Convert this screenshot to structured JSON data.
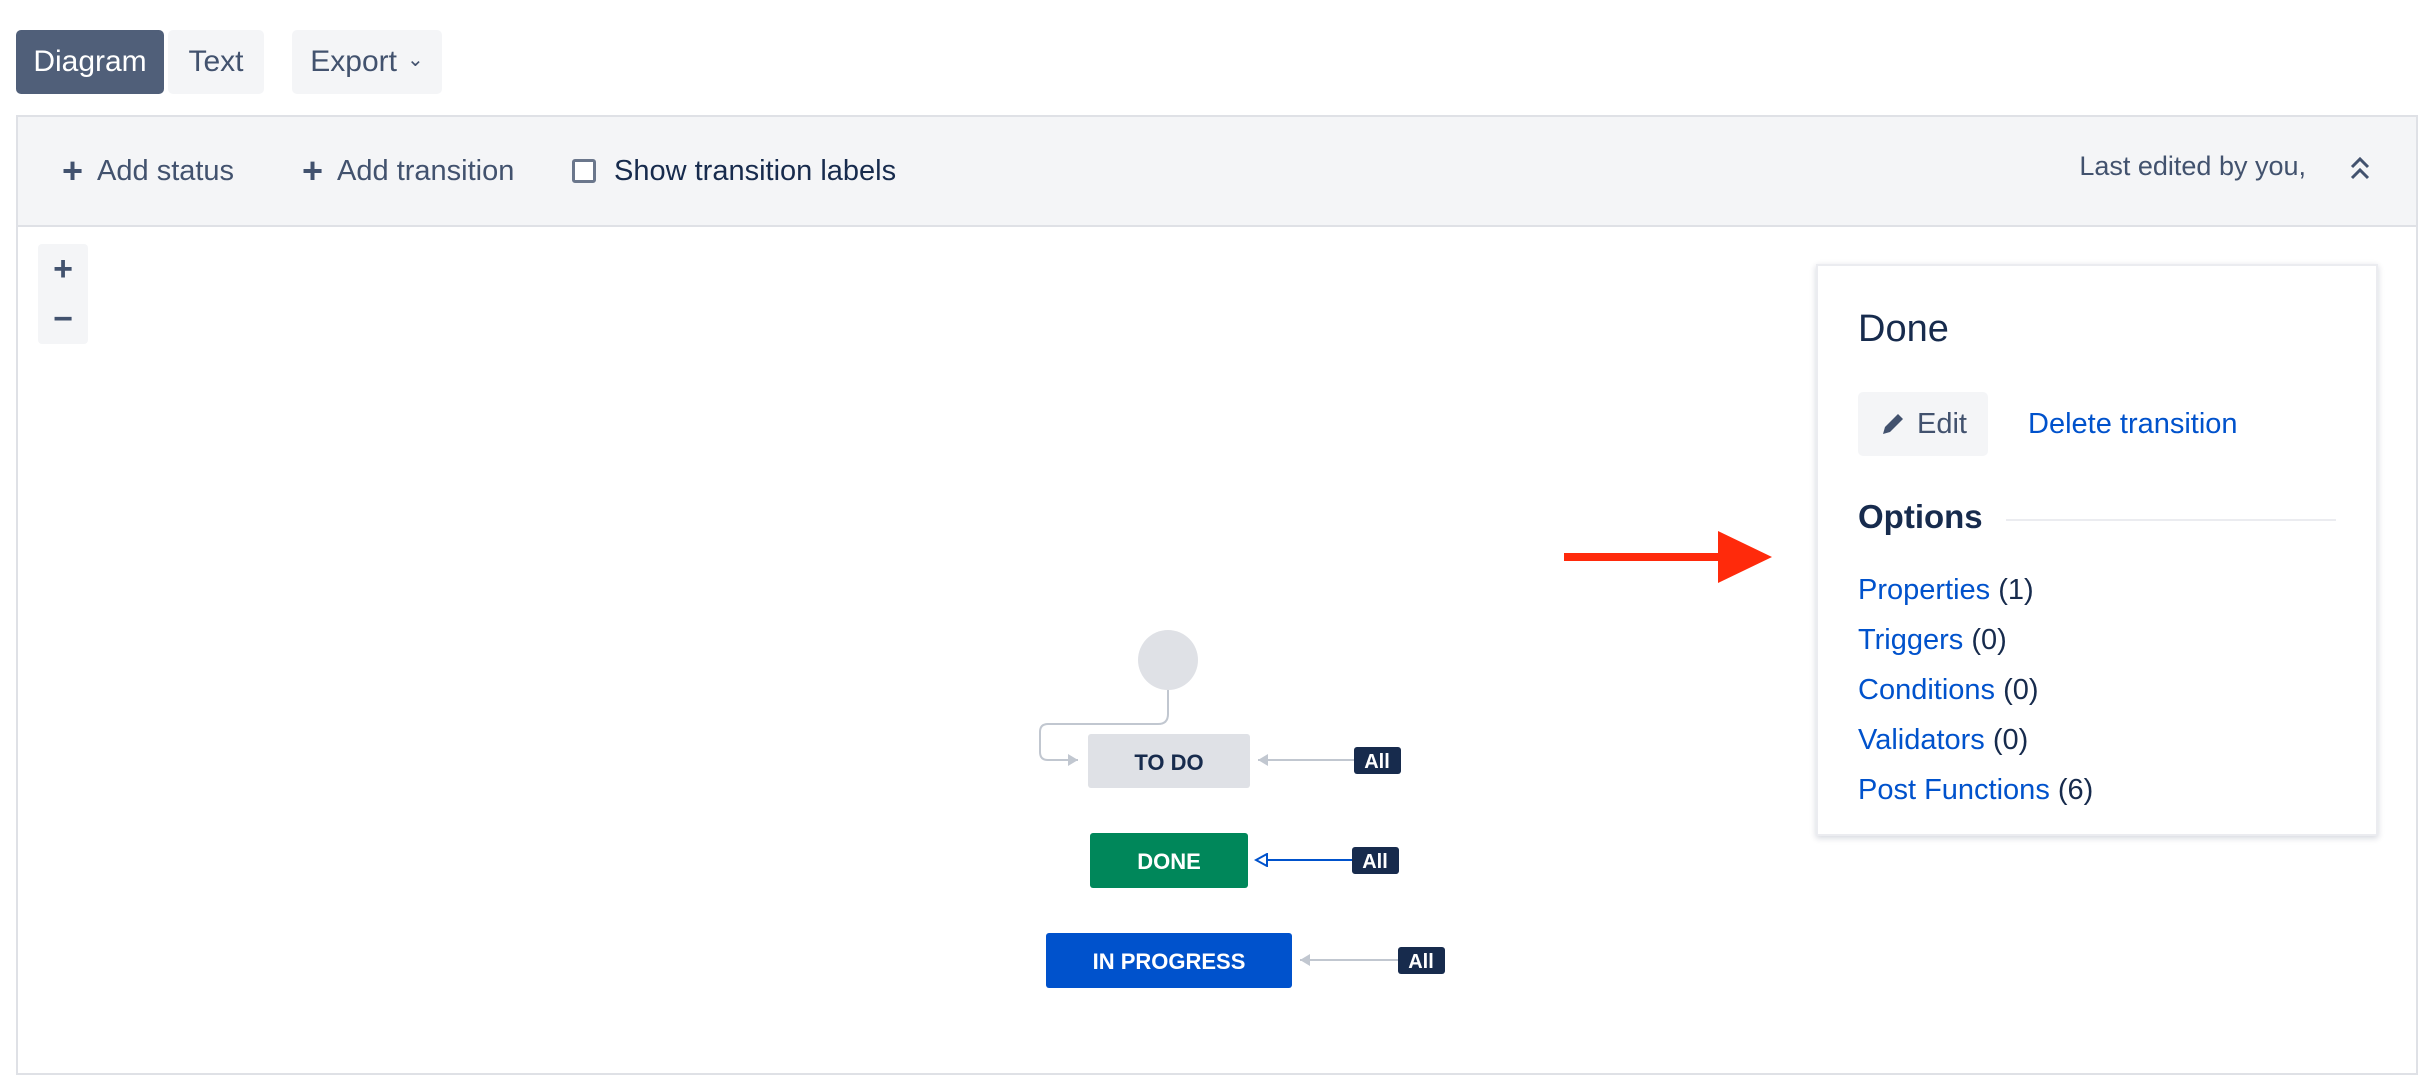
{
  "view_tabs": {
    "diagram": "Diagram",
    "text": "Text",
    "export": "Export"
  },
  "toolbar": {
    "add_status": "Add status",
    "add_transition": "Add transition",
    "show_transition_labels": "Show transition labels",
    "show_transition_labels_checked": false,
    "last_edited": "Last edited by you,"
  },
  "zoom": {
    "in": "+",
    "out": "−"
  },
  "diagram": {
    "statuses": [
      {
        "label": "TO DO",
        "color": "#dfe1e6",
        "text_color": "#172b4d"
      },
      {
        "label": "DONE",
        "color": "#00875a",
        "text_color": "#ffffff"
      },
      {
        "label": "IN PROGRESS",
        "color": "#0052cc",
        "text_color": "#ffffff"
      }
    ],
    "global_transition_label": "All"
  },
  "panel": {
    "title": "Done",
    "edit": "Edit",
    "delete_transition": "Delete transition",
    "options_heading": "Options",
    "options": [
      {
        "label": "Properties",
        "count": "(1)"
      },
      {
        "label": "Triggers",
        "count": "(0)"
      },
      {
        "label": "Conditions",
        "count": "(0)"
      },
      {
        "label": "Validators",
        "count": "(0)"
      },
      {
        "label": "Post Functions",
        "count": "(6)"
      }
    ]
  },
  "colors": {
    "primary_tab": "#505f79",
    "link": "#0052cc",
    "annotation_arrow": "#ff2a0b",
    "badge": "#172b4d"
  }
}
